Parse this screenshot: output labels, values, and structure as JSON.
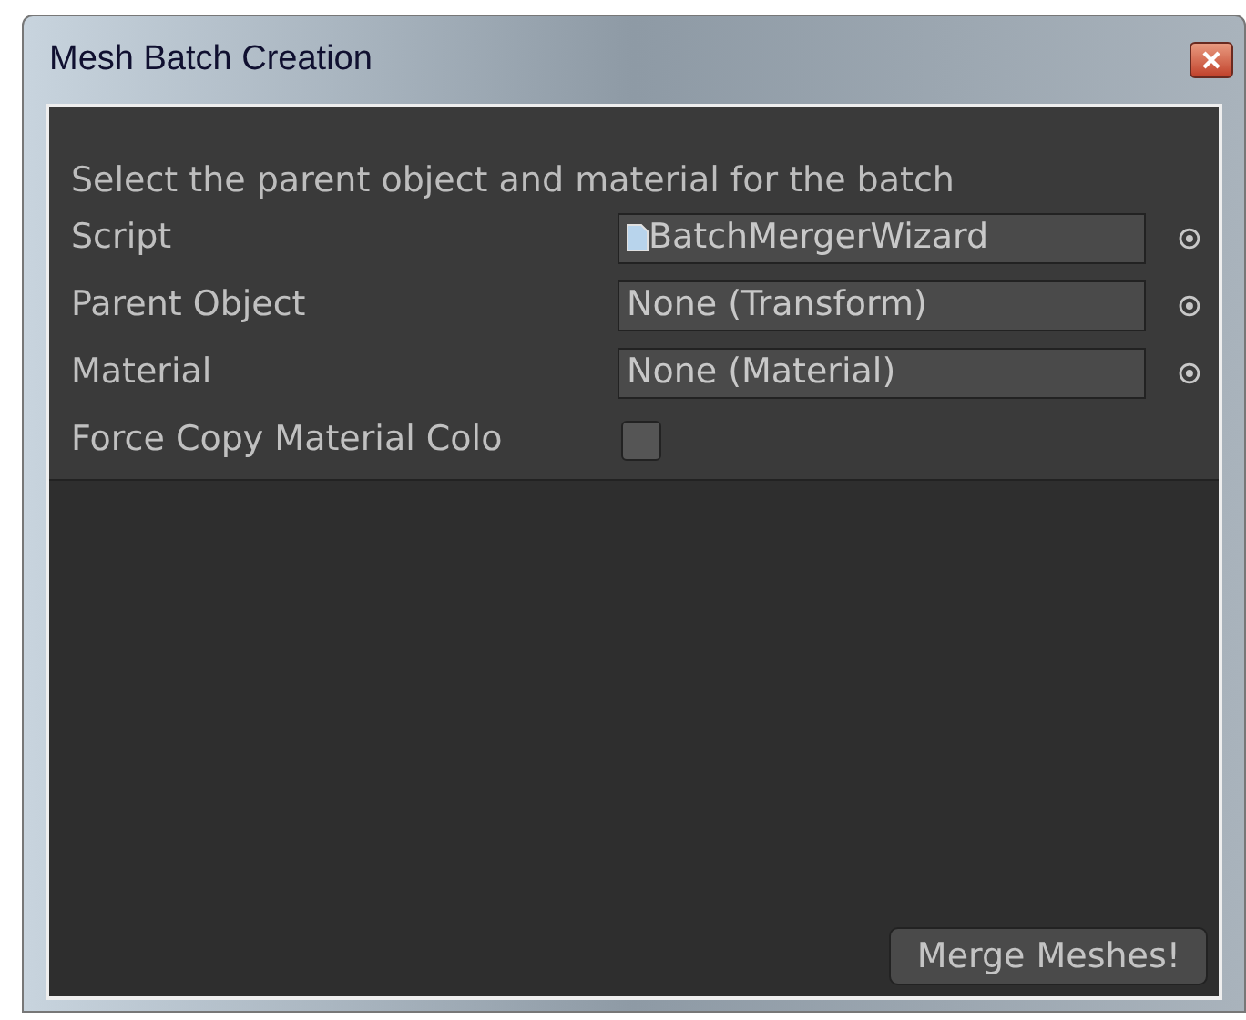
{
  "window": {
    "title": "Mesh Batch Creation"
  },
  "help_text": "Select the parent object and material for the batch",
  "properties": [
    {
      "kind": "object",
      "label": "Script",
      "value": "BatchMergerWizard",
      "has_script_icon": true
    },
    {
      "kind": "object",
      "label": "Parent Object",
      "value": "None (Transform)",
      "has_script_icon": false
    },
    {
      "kind": "object",
      "label": "Material",
      "value": "None (Material)",
      "has_script_icon": false
    },
    {
      "kind": "checkbox",
      "label": "Force Copy Material Colo",
      "checked": false
    }
  ],
  "button": "Merge Meshes!"
}
